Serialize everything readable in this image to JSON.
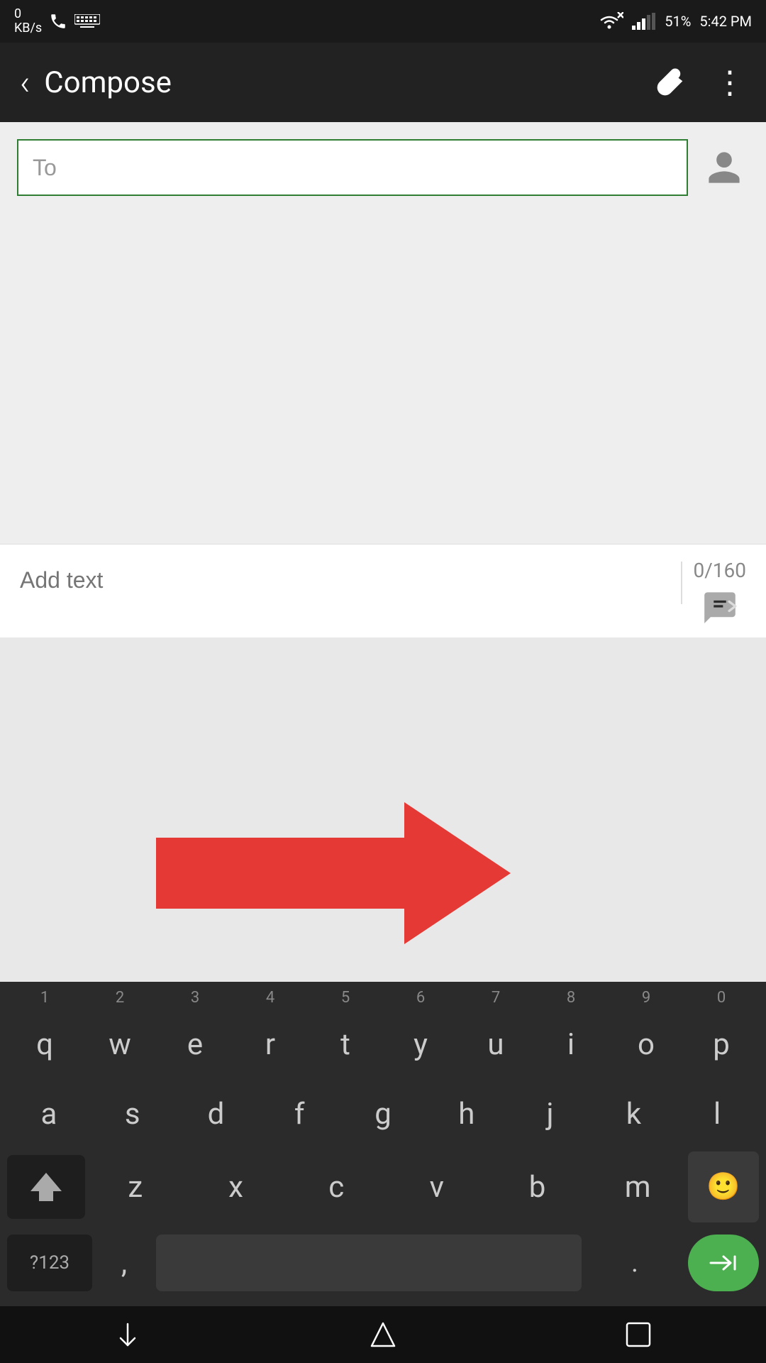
{
  "statusBar": {
    "leftItems": {
      "kbps": "0\nKB/s",
      "phone": "📞",
      "keyboard": "⌨"
    },
    "rightItems": {
      "wifi": "WiFi",
      "signal": "Signal",
      "battery": "51%",
      "time": "5:42 PM"
    }
  },
  "appBar": {
    "backLabel": "‹",
    "title": "Compose",
    "attachLabel": "📎",
    "moreLabel": "⋮"
  },
  "toField": {
    "placeholder": "To",
    "value": ""
  },
  "messageField": {
    "placeholder": "Add text",
    "charCount": "0/160"
  },
  "keyboard": {
    "row1": [
      "q",
      "w",
      "e",
      "r",
      "t",
      "y",
      "u",
      "i",
      "o",
      "p"
    ],
    "row1nums": [
      "1",
      "2",
      "3",
      "4",
      "5",
      "6",
      "7",
      "8",
      "9",
      "0"
    ],
    "row2": [
      "a",
      "s",
      "d",
      "f",
      "g",
      "h",
      "j",
      "k",
      "l"
    ],
    "row3": [
      "z",
      "x",
      "c",
      "v",
      "b",
      "m"
    ],
    "specials": {
      "symbols": "?123",
      "comma": ",",
      "period": ".",
      "emoji": "😊",
      "tab": "→|"
    }
  },
  "navBar": {
    "backLabel": "∨",
    "homeLabel": "⬡",
    "recentLabel": "⬜"
  },
  "arrow": {
    "visible": true
  }
}
